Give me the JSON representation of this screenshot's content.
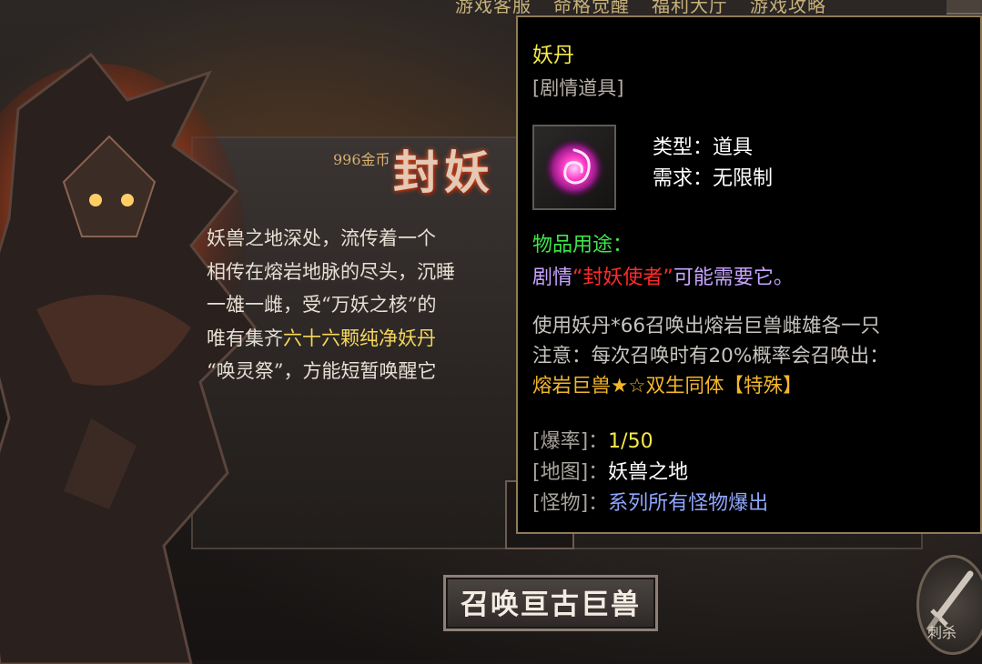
{
  "top_nav": [
    "游戏客服",
    "命格觉醒",
    "福利大厅",
    "游戏攻略"
  ],
  "panel": {
    "level_tag": "996金币",
    "title_fragment": "封妖",
    "story_lines": [
      {
        "text": "妖兽之地深处，流传着一个",
        "highlight": ""
      },
      {
        "text": "相传在熔岩地脉的尽头，沉睡",
        "highlight": ""
      },
      {
        "text": "一雄一雌，受“万妖之核”的",
        "highlight": ""
      },
      {
        "text": "唯有集齐",
        "highlight": "六十六颗纯净妖丹"
      },
      {
        "text": "“唤灵祭”，方能短暂唤醒它",
        "highlight": ""
      }
    ],
    "summon_button": "召唤亘古巨兽",
    "skill_label": "刺杀"
  },
  "tooltip": {
    "name": "妖丹",
    "category": "[剧情道具]",
    "type_label": "类型：",
    "type_value": "道具",
    "req_label": "需求：",
    "req_value": "无限制",
    "usage_heading": "物品用途：",
    "usage_pre": "剧情",
    "usage_red": "“封妖使者”",
    "usage_post": "可能需要它。",
    "desc_line1": "使用妖丹*66召唤出熔岩巨兽雌雄各一只",
    "desc_line2": "注意：每次召唤时有20%概率会召唤出：",
    "desc_line3": "熔岩巨兽★☆双生同体【特殊】",
    "drop_rate_label": "[爆率]：",
    "drop_rate_value": "1/50",
    "map_label": "[地图]：",
    "map_value": "妖兽之地",
    "monster_label": "[怪物]：",
    "monster_value": "系列所有怪物爆出"
  },
  "colors": {
    "item_name": "#f6e94a",
    "usage_heading": "#3fe64a",
    "usage_text": "#c7a4ff",
    "usage_red": "#ff2a2a",
    "special_gold": "#f3b72a",
    "monster_blue": "#8fa6ff",
    "tooltip_border": "#8f7b55"
  },
  "icons": {
    "item": "magenta-swirl-orb-icon",
    "skill": "sword-icon"
  }
}
